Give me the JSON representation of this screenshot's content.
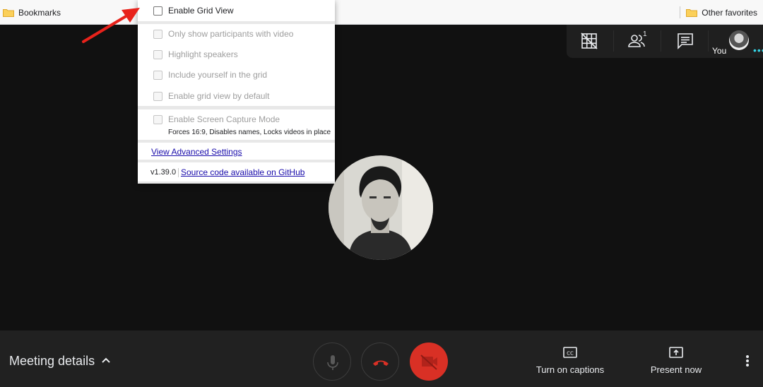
{
  "bookmarks_bar": {
    "left_folder": "Bookmarks",
    "right_folder": "Other favorites"
  },
  "top_right": {
    "you_label": "You",
    "participants_count": "1"
  },
  "menu": {
    "enable_grid_view": "Enable Grid View",
    "only_video": "Only show participants with video",
    "highlight_speakers": "Highlight speakers",
    "include_yourself": "Include yourself in the grid",
    "grid_default": "Enable grid view by default",
    "screen_capture": "Enable Screen Capture Mode",
    "screen_capture_note": "Forces 16:9, Disables names, Locks videos in place",
    "advanced_settings": "View Advanced Settings",
    "version": "v1.39.0",
    "source_link": "Source code available on GitHub"
  },
  "bottom": {
    "meeting_details": "Meeting details",
    "captions": "Turn on captions",
    "present": "Present now"
  },
  "colors": {
    "accent_arrow": "#e8221b",
    "hangup": "#d93025",
    "self_dots": "#34d5e6",
    "link": "#1a0dab"
  },
  "icons": {
    "folder": "folder-icon",
    "grid_toggle": "grid-toggle-icon",
    "people": "people-icon",
    "chat": "chat-icon",
    "mic": "mic-icon",
    "hangup": "hangup-icon",
    "camera_off": "camera-off-icon",
    "captions": "captions-icon",
    "present": "present-icon",
    "more": "more-vert-icon"
  }
}
